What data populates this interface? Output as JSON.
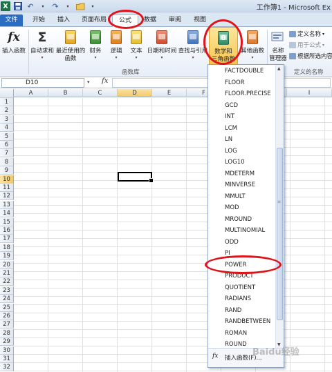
{
  "window": {
    "title": "工作簿1 - Microsoft Ex"
  },
  "tabs": [
    {
      "label": "文件"
    },
    {
      "label": "开始"
    },
    {
      "label": "插入"
    },
    {
      "label": "页面布局"
    },
    {
      "label": "公式"
    },
    {
      "label": "数据"
    },
    {
      "label": "审阅"
    },
    {
      "label": "视图"
    }
  ],
  "ribbon": {
    "insert_function": "插入函数",
    "autosum": "自动求和",
    "recent": "最近使用的",
    "recent2": "函数",
    "financial": "财务",
    "logical": "逻辑",
    "text": "文本",
    "datetime": "日期和时间",
    "lookup": "查找与引用",
    "math": "数学和",
    "math2": "三角函数",
    "other": "其他函数",
    "name_manager": "名称",
    "name_manager2": "管理器",
    "define_name": "定义名称",
    "use_in_formula": "用于公式",
    "create_from_sel": "根据所选内容",
    "group_function_library": "函数库",
    "group_defined_names": "定义的名称"
  },
  "formula_bar": {
    "name_box": "D10",
    "fx": "fx"
  },
  "grid": {
    "columns": [
      "A",
      "B",
      "C",
      "D",
      "E",
      "F",
      "",
      "I"
    ],
    "rows": [
      "1",
      "2",
      "3",
      "4",
      "5",
      "6",
      "7",
      "8",
      "9",
      "10",
      "11",
      "12",
      "13",
      "14",
      "15",
      "16",
      "17",
      "18",
      "19",
      "20",
      "21",
      "22",
      "23",
      "24",
      "25",
      "26",
      "27",
      "28",
      "29",
      "30",
      "31",
      "32"
    ],
    "selected_cell": "D10"
  },
  "dropdown": {
    "items": [
      "FACTDOUBLE",
      "FLOOR",
      "FLOOR.PRECISE",
      "GCD",
      "INT",
      "LCM",
      "LN",
      "LOG",
      "LOG10",
      "MDETERM",
      "MINVERSE",
      "MMULT",
      "MOD",
      "MROUND",
      "MULTINOMIAL",
      "ODD",
      "PI",
      "POWER",
      "PRODUCT",
      "QUOTIENT",
      "RADIANS",
      "RAND",
      "RANDBETWEEN",
      "ROMAN",
      "ROUND"
    ],
    "highlighted": "POWER",
    "footer_fx": "fx",
    "footer_label": "插入函数(F)..."
  },
  "watermark": "Baidu经验",
  "colors": {
    "annotation": "#e0141b",
    "file_tab": "#2b6cc4",
    "selected_header": "#f2c76a"
  }
}
